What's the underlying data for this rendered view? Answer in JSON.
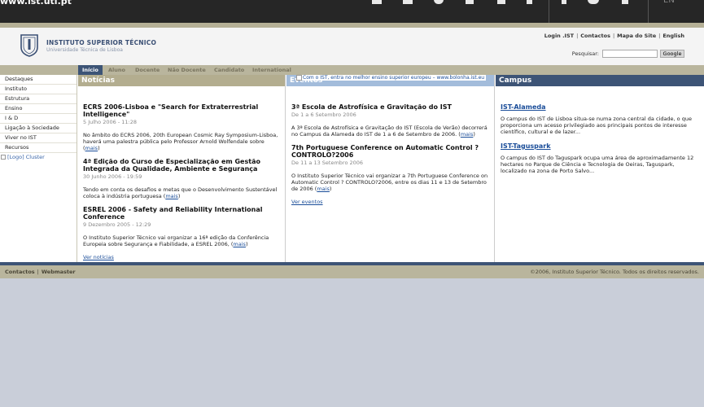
{
  "topbar": {
    "url_fragment": "www.ist.utl.pt",
    "lang": "EN"
  },
  "header": {
    "logo_line1": "INSTITUTO SUPERIOR TÉCNICO",
    "logo_line2": "Universidade Técnica de Lisboa",
    "links": [
      "Login .IST",
      "Contactos",
      "Mapa do Site",
      "English"
    ],
    "search_label": "Pesquisar:",
    "search_value": "",
    "search_button": "Google"
  },
  "nav": {
    "tabs": [
      "Início",
      "Aluno",
      "Docente",
      "Não Docente",
      "Candidato",
      "International"
    ]
  },
  "sidebar": {
    "items": [
      "Destaques",
      "Instituto",
      "Estrutura",
      "Ensino",
      "I & D",
      "Ligação à Sociedade",
      "Viver no IST",
      "Recursos"
    ],
    "image_alt": "[Logo] Cluster"
  },
  "banner": {
    "alt": "Com o IST, entra no melhor ensino superior europeu – www.bolonha.ist.eu"
  },
  "news": {
    "heading": "Notícias",
    "items": [
      {
        "title": "ECRS 2006-Lisboa e \"Search for Extraterrestrial Intelligence\"",
        "date": "5 Julho 2006 - 11:28",
        "text": "No âmbito do ECRS 2006, 20th European Cosmic Ray Symposium-Lisboa, haverá uma palestra pública pelo Professor Arnold Wolfendale sobre",
        "more": "mais"
      },
      {
        "title": "4ª Edição do Curso de Especialização em Gestão Integrada da Qualidade, Ambiente e Segurança",
        "date": "30 Junho 2006 - 19:59",
        "text": "Tendo em conta os desafios e metas que o Desenvolvimento Sustentável coloca à indústria portuguesa",
        "more": "mais"
      },
      {
        "title": "ESREL 2006 - Safety and Reliability International Conference",
        "date": "9 Dezembro 2005 - 12:29",
        "text": "O Instituto Superior Técnico vai organizar a 16ª edição da Conferência Europeia sobre Segurança e Fiabilidade, a ESREL 2006,",
        "more": "mais"
      }
    ],
    "see_all": "Ver notícias"
  },
  "events": {
    "heading": "Eventos",
    "items": [
      {
        "title": "3ª Escola de Astrofísica e Gravitação do IST",
        "date": "De 1 a 6 Setembro 2006",
        "text": "A 3ª Escola de Astrofísica e Gravitação do IST (Escola de Verão) decorrerá no Campus da Alameda do IST de 1 a 6 de Setembro de 2006.",
        "more": "mais"
      },
      {
        "title": "7th Portuguese Conference on Automatic Control ? CONTROLO?2006",
        "date": "De 11 a 13 Setembro 2006",
        "text": "O Instituto Superior Técnico vai organizar a 7th Portuguese Conference on Automatic Control ? CONTROLO?2006, entre os dias 11 e 13 de Setembro de 2006",
        "more": "mais"
      }
    ],
    "see_all": "Ver eventos"
  },
  "campus": {
    "heading": "Campus",
    "items": [
      {
        "title": "IST-Alameda",
        "text": "O campus do IST de Lisboa situa-se numa zona central da cidade, o que proporciona um acesso privilegiado aos principais pontos de interesse científico, cultural e de lazer..."
      },
      {
        "title": "IST-Taguspark",
        "text": "O campus do IST do Taguspark ocupa uma área de aproximadamente 12 hectares no Parque de Ciência e Tecnologia de Oeiras, Taguspark, localizado na zona de Porto Salvo..."
      }
    ]
  },
  "footer": {
    "links": [
      "Contactos",
      "Webmaster"
    ],
    "copyright": "©2006, Instituto Superior Técnico. Todos os direitos reservados."
  }
}
